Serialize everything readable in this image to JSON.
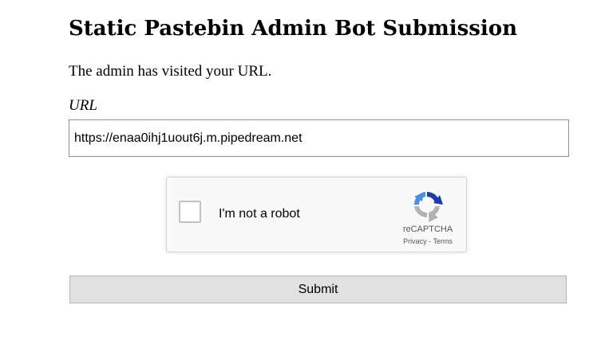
{
  "page": {
    "title": "Static Pastebin Admin Bot Submission",
    "status_message": "The admin has visited your URL."
  },
  "form": {
    "url_label": "URL",
    "url_value": "https://enaa0ihj1uout6j.m.pipedream.net",
    "submit_label": "Submit"
  },
  "recaptcha": {
    "checkbox_label": "I'm not a robot",
    "checked": false,
    "brand": "reCAPTCHA",
    "privacy_label": "Privacy",
    "separator": "-",
    "terms_label": "Terms",
    "icon": "recaptcha-logo-icon",
    "colors": {
      "blue": "#4a90e2",
      "dark_blue": "#1c3aa9",
      "gray": "#b3b3b3"
    }
  }
}
